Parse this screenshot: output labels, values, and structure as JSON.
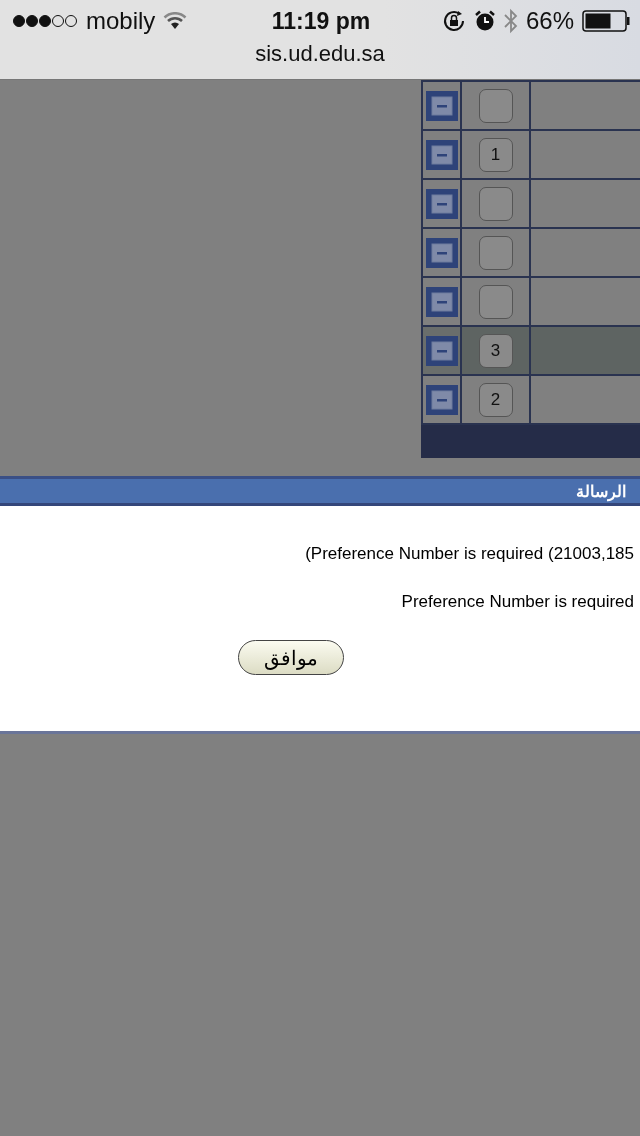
{
  "status_bar": {
    "carrier": "mobily",
    "time": "11:19 pm",
    "battery": "66%",
    "url": "sis.ud.edu.sa"
  },
  "table": {
    "rows": [
      {
        "value": "",
        "selected": false
      },
      {
        "value": "1",
        "selected": false
      },
      {
        "value": "",
        "selected": false
      },
      {
        "value": "",
        "selected": false
      },
      {
        "value": "",
        "selected": false
      },
      {
        "value": "3",
        "selected": true
      },
      {
        "value": "2",
        "selected": false
      }
    ]
  },
  "dialog": {
    "title": "الرسالة",
    "messages": [
      "(Preference Number is required (21003,185",
      "Preference Number is required"
    ],
    "button": "موافق"
  }
}
